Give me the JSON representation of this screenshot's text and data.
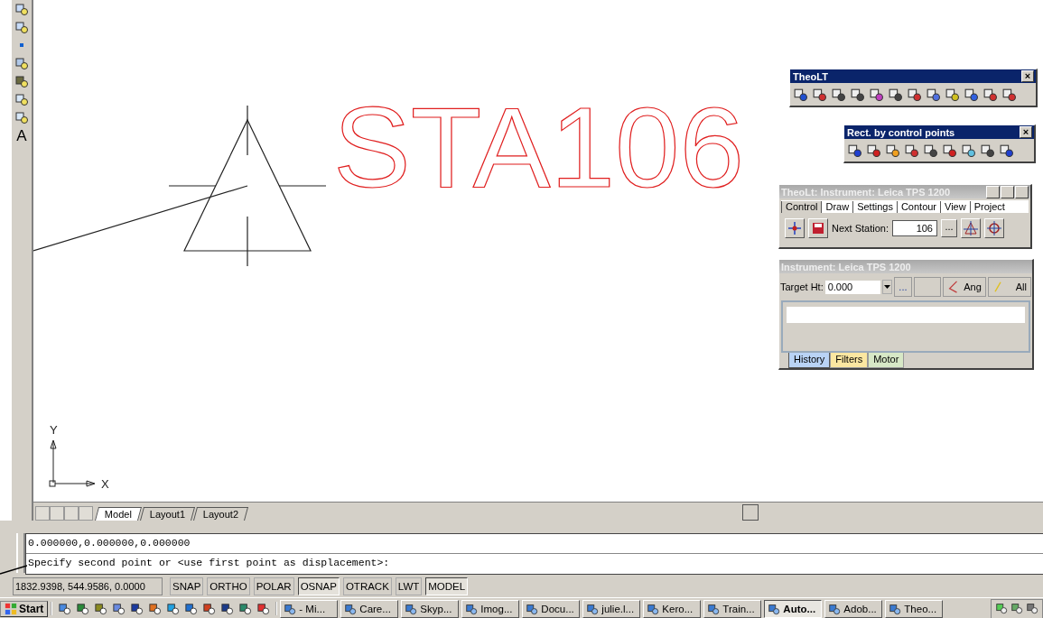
{
  "left_toolbar": {
    "text_tool": "A"
  },
  "drawing": {
    "label": "STA106",
    "ucs_y": "Y",
    "ucs_x": "X"
  },
  "layout_tabs": [
    {
      "label": "Model",
      "selected": true
    },
    {
      "label": "Layout1",
      "selected": false
    },
    {
      "label": "Layout2",
      "selected": false
    }
  ],
  "command_line": {
    "history": "0.000000,0.000000,0.000000",
    "prompt": "Specify second point or <use first point as displacement>:"
  },
  "status_bar": {
    "coordinates": "1832.9398, 544.9586, 0.0000",
    "toggles": [
      {
        "label": "SNAP",
        "on": false
      },
      {
        "label": "ORTHO",
        "on": false
      },
      {
        "label": "POLAR",
        "on": false
      },
      {
        "label": "OSNAP",
        "on": true
      },
      {
        "label": "OTRACK",
        "on": false
      },
      {
        "label": "LWT",
        "on": false
      },
      {
        "label": "MODEL",
        "on": true
      }
    ]
  },
  "theolt_toolbar": {
    "title": "TheoLT",
    "close": "×"
  },
  "rect_toolbar": {
    "title": "Rect. by control points",
    "close": "×"
  },
  "instrument_window": {
    "title": "TheoLt: Instrument: Leica TPS 1200",
    "tabs": [
      {
        "label": "Control",
        "selected": true
      },
      {
        "label": "Draw",
        "selected": false
      },
      {
        "label": "Settings",
        "selected": false
      },
      {
        "label": "Contour",
        "selected": false
      },
      {
        "label": "View",
        "selected": false
      },
      {
        "label": "Project",
        "selected": false
      }
    ],
    "next_station_label": "Next Station:",
    "next_station": "106",
    "browse": "..."
  },
  "instrument_panel": {
    "title": "Instrument: Leica TPS 1200",
    "target_label": "Target Ht:",
    "target_value": "0.000",
    "more": "...",
    "ang": "Ang",
    "all": "All",
    "tabs": [
      {
        "label": "History",
        "selected": true,
        "color": "#b9d3f5"
      },
      {
        "label": "Filters",
        "selected": false,
        "color": "#fbe7a1"
      },
      {
        "label": "Motor",
        "selected": false,
        "color": "#d7e8c6"
      }
    ]
  },
  "taskbar": {
    "start": "Start",
    "tasks": [
      {
        "label": "- Mi...",
        "selected": false
      },
      {
        "label": "Care...",
        "selected": false
      },
      {
        "label": "Skyp...",
        "selected": false
      },
      {
        "label": "Imog...",
        "selected": false
      },
      {
        "label": "Docu...",
        "selected": false
      },
      {
        "label": "julie.l...",
        "selected": false
      },
      {
        "label": "Kero...",
        "selected": false
      },
      {
        "label": "Train...",
        "selected": false
      },
      {
        "label": "Auto...",
        "selected": true
      },
      {
        "label": "Adob...",
        "selected": false
      },
      {
        "label": "Theo...",
        "selected": false
      }
    ]
  }
}
